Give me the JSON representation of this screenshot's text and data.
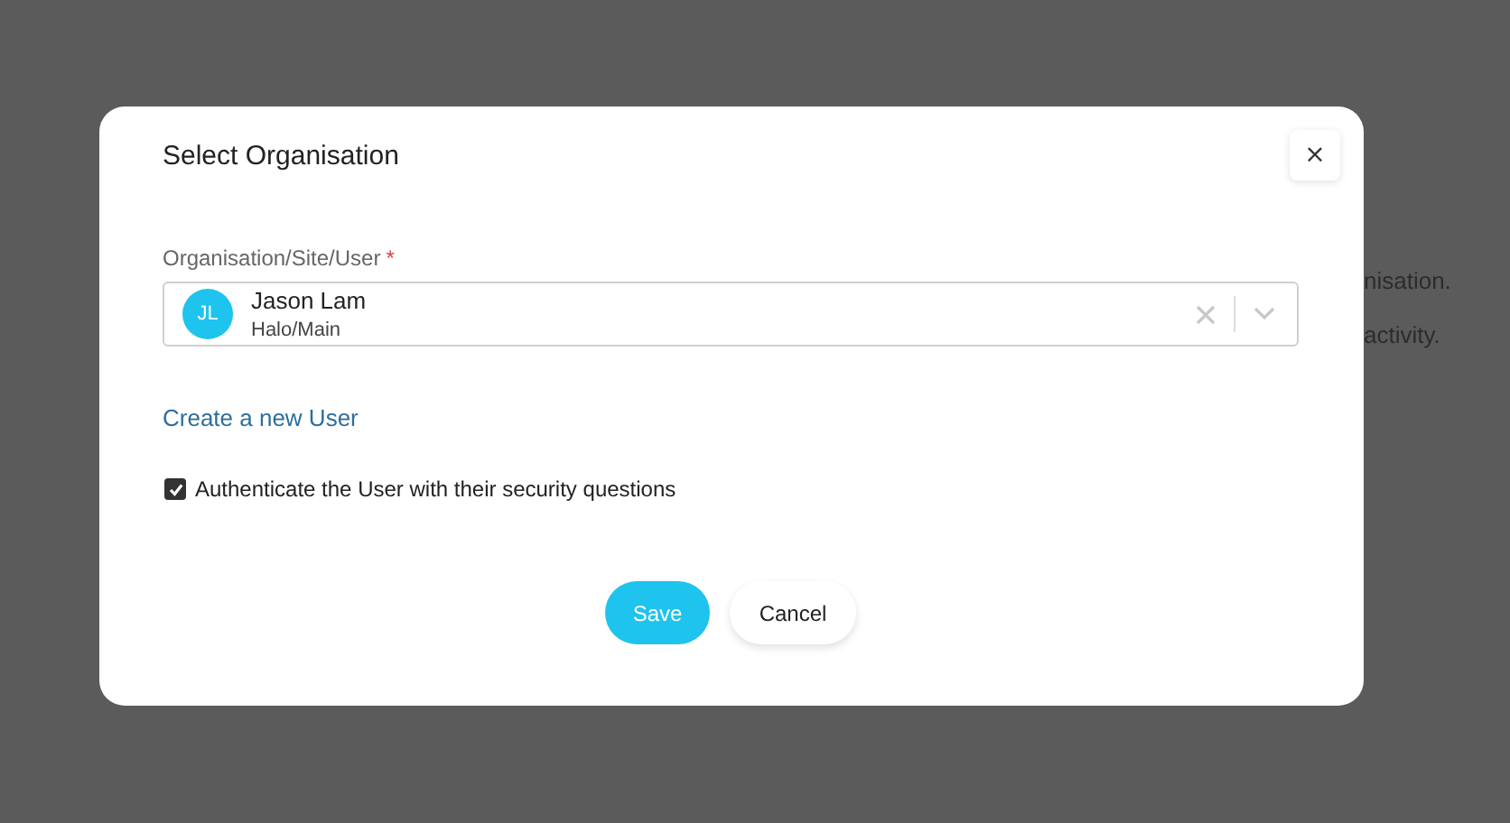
{
  "background": {
    "lines": [
      "nisation.",
      "activity."
    ]
  },
  "dialog": {
    "title": "Select Organisation",
    "close": "×",
    "field": {
      "label": "Organisation/Site/User",
      "required_mark": "*",
      "avatar_initials": "JL",
      "value": "Jason Lam",
      "subvalue": "Halo/Main"
    },
    "link": "Create a new User",
    "checkbox": {
      "label": "Authenticate the User with their security questions",
      "checked": true
    },
    "buttons": [
      {
        "label": "Save",
        "kind": "primary"
      },
      {
        "label": "Cancel",
        "kind": "secondary"
      }
    ]
  }
}
